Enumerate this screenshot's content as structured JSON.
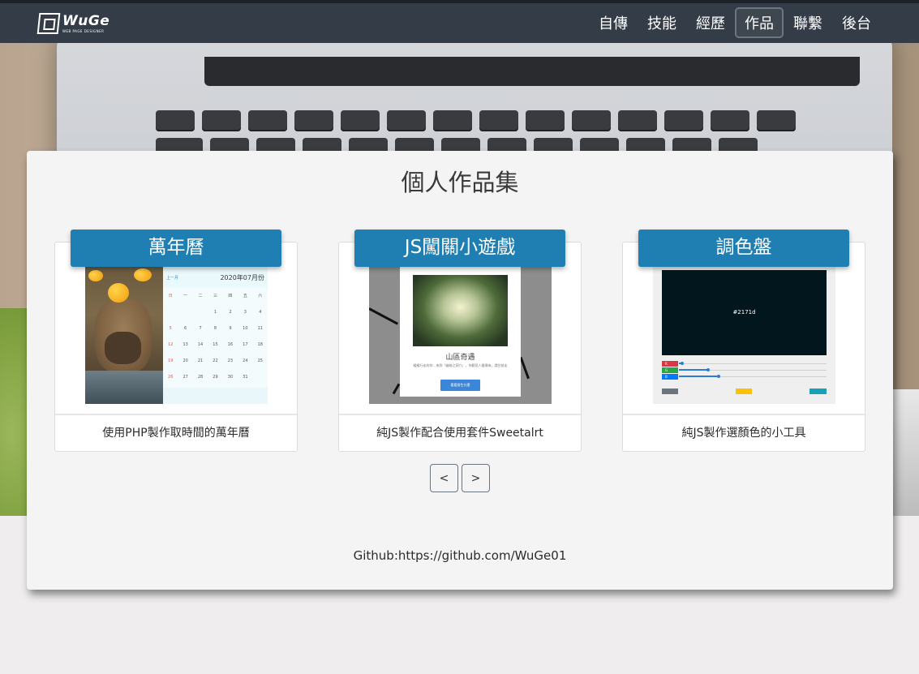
{
  "navbar": {
    "logo_name": "WuGe",
    "logo_sub": "WEB PAGE DESIGNER",
    "items": [
      {
        "label": "自傳"
      },
      {
        "label": "技能"
      },
      {
        "label": "經歷"
      },
      {
        "label": "作品",
        "active": true
      },
      {
        "label": "聯繫"
      },
      {
        "label": "後台"
      }
    ]
  },
  "main": {
    "title": "個人作品集",
    "cards": [
      {
        "title": "萬年曆",
        "caption": "使用PHP製作取時間的萬年曆",
        "thumb": {
          "month": "2020年07月份",
          "prev": "上一月",
          "weekdays": [
            "日",
            "一",
            "二",
            "三",
            "四",
            "五",
            "六"
          ],
          "days": [
            "",
            "",
            "",
            "1",
            "2",
            "3",
            "4",
            "5",
            "6",
            "7",
            "8",
            "9",
            "10",
            "11",
            "12",
            "13",
            "14",
            "15",
            "16",
            "17",
            "18",
            "19",
            "20",
            "21",
            "22",
            "23",
            "24",
            "25",
            "26",
            "27",
            "28",
            "29",
            "30",
            "31",
            ""
          ]
        }
      },
      {
        "title": "JS闖關小遊戲",
        "caption": "純JS製作配合使用套件Sweetalrt",
        "thumb": {
          "dialog_title": "山區奇遇",
          "dialog_text": "緩緩行走的你…來到「幽暗之洞穴」，你聽見人聲傳來，請往前走",
          "button": "看看發生什麼"
        }
      },
      {
        "title": "調色盤",
        "caption": "純JS製作選顏色的小工具",
        "thumb": {
          "color_hex": "#2171d",
          "channels": [
            {
              "label": "R",
              "color": "#dc3545",
              "value": 0.02
            },
            {
              "label": "G",
              "color": "#28a745",
              "value": 0.2
            },
            {
              "label": "B",
              "color": "#007bff",
              "value": 0.27
            }
          ]
        }
      }
    ],
    "pager": {
      "prev": "<",
      "next": ">"
    },
    "footer": "Github:https://github.com/WuGe01"
  },
  "colors": {
    "navbar": "#343d47",
    "banner": "#1f7fb2",
    "panel": "#f4f4f4",
    "page_bg": "#efeded"
  }
}
